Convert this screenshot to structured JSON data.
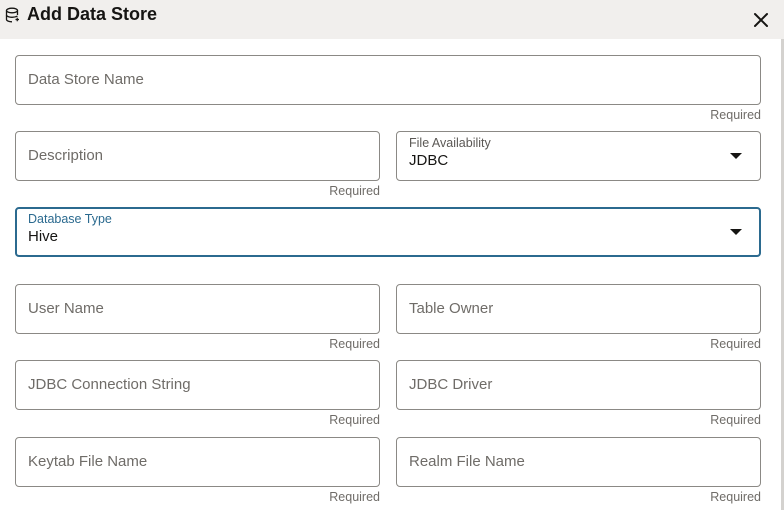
{
  "dialog": {
    "title": "Add Data Store",
    "icon": "database-icon",
    "close_icon": "close-icon"
  },
  "form": {
    "data_store_name": {
      "placeholder": "Data Store Name",
      "helper": "Required"
    },
    "description": {
      "placeholder": "Description",
      "helper": "Required"
    },
    "file_availability": {
      "label": "File Availability",
      "value": "JDBC"
    },
    "database_type": {
      "label": "Database Type",
      "value": "Hive"
    },
    "user_name": {
      "placeholder": "User Name",
      "helper": "Required"
    },
    "table_owner": {
      "placeholder": "Table Owner",
      "helper": "Required"
    },
    "jdbc_connection_string": {
      "placeholder": "JDBC Connection String",
      "helper": "Required"
    },
    "jdbc_driver": {
      "placeholder": "JDBC Driver",
      "helper": "Required"
    },
    "keytab_file_name": {
      "placeholder": "Keytab File Name",
      "helper": "Required"
    },
    "realm_file_name": {
      "placeholder": "Realm File Name",
      "helper": "Required"
    }
  },
  "colors": {
    "header_bg": "#f1efed",
    "focus_accent": "#2b6a8f",
    "border": "#8b8985"
  }
}
